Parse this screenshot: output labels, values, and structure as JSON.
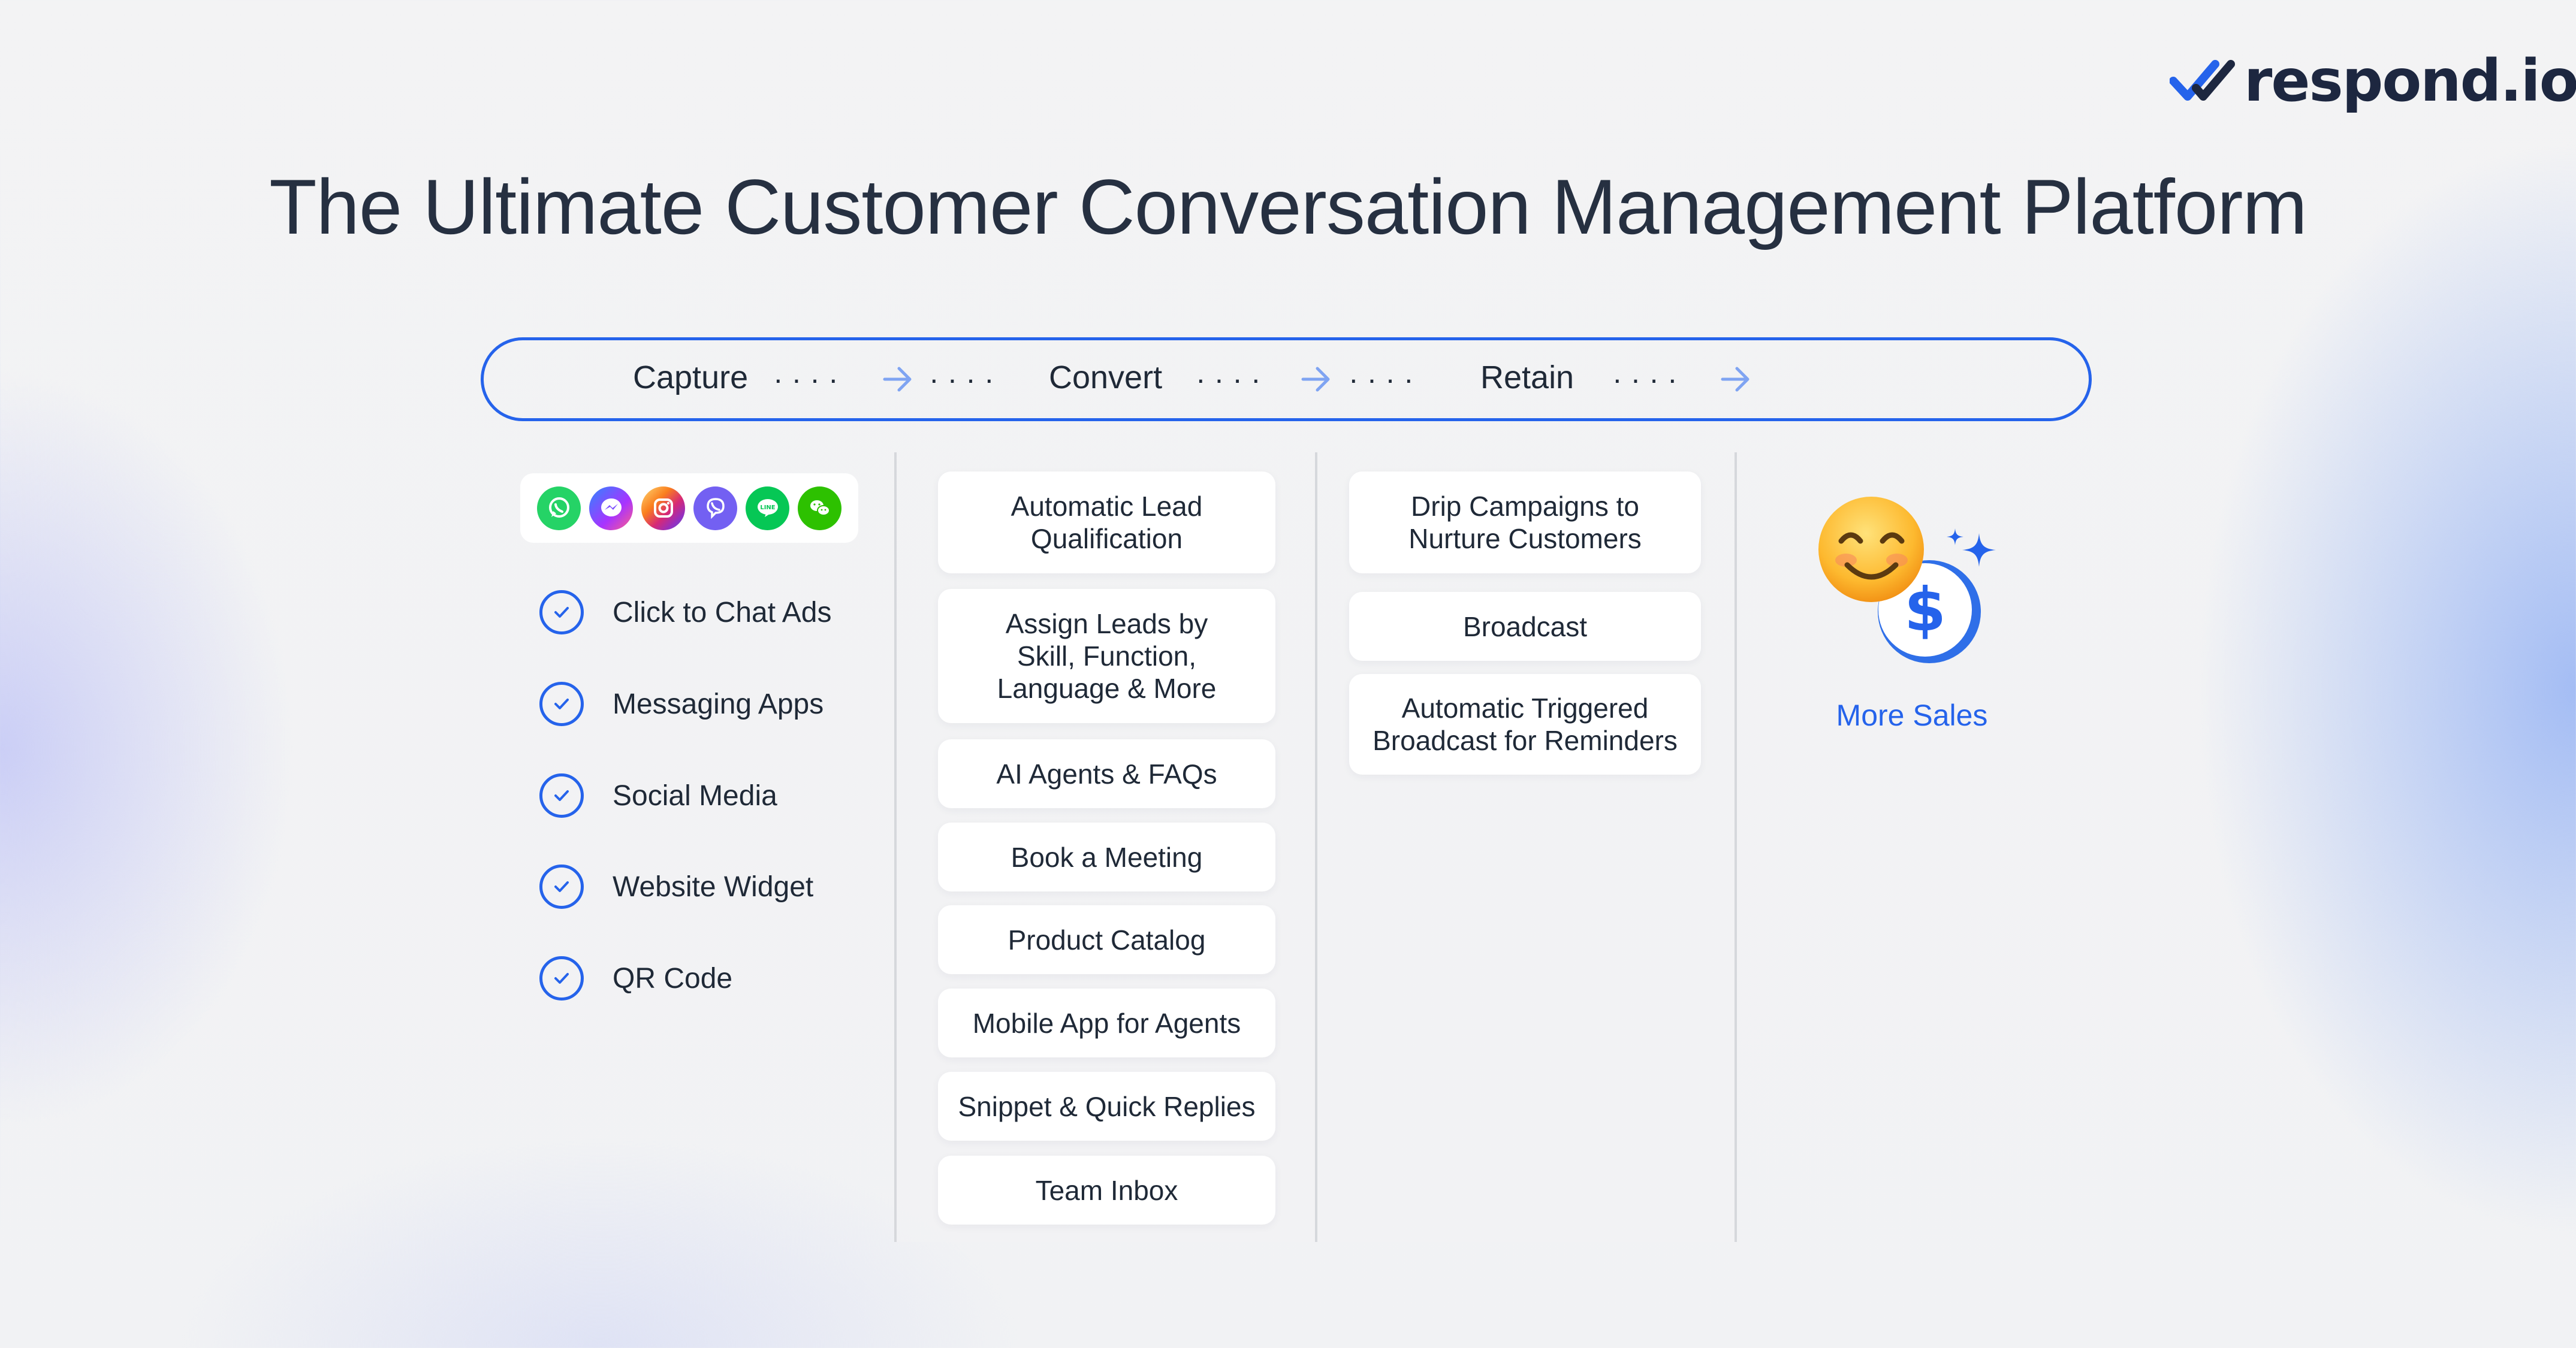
{
  "brand": {
    "logo_text": "respond.io",
    "accent_color": "#2563eb",
    "logo_icon": "double-check-logo-icon"
  },
  "page": {
    "title": "The Ultimate Customer Conversation Management Platform"
  },
  "flow": {
    "stages": [
      "Capture",
      "Convert",
      "Retain"
    ],
    "arrow_icon": "arrow-right-icon"
  },
  "capture": {
    "apps": [
      {
        "name": "whatsapp-icon",
        "color": "#25d366"
      },
      {
        "name": "messenger-icon",
        "color": "#7b4dff"
      },
      {
        "name": "instagram-icon",
        "color": "#e1306c"
      },
      {
        "name": "viber-icon",
        "color": "#7360f2"
      },
      {
        "name": "line-icon",
        "color": "#06c755"
      },
      {
        "name": "wechat-icon",
        "color": "#2dc100"
      }
    ],
    "items": [
      "Click to Chat Ads",
      "Messaging Apps",
      "Social Media",
      "Website Widget",
      "QR Code"
    ]
  },
  "convert": {
    "items": [
      "Automatic Lead\nQualification",
      "Assign Leads by\nSkill, Function,\nLanguage & More",
      "AI Agents & FAQs",
      "Book a Meeting",
      "Product Catalog",
      "Mobile App for Agents",
      "Snippet & Quick Replies",
      "Team Inbox"
    ]
  },
  "retain": {
    "items": [
      "Drip Campaigns to\nNurture Customers",
      "Broadcast",
      "Automatic Triggered\nBroadcast for Reminders"
    ]
  },
  "outcome": {
    "label": "More Sales",
    "icons": [
      "smiling-face-icon",
      "dollar-coin-icon",
      "sparkle-icon"
    ]
  }
}
